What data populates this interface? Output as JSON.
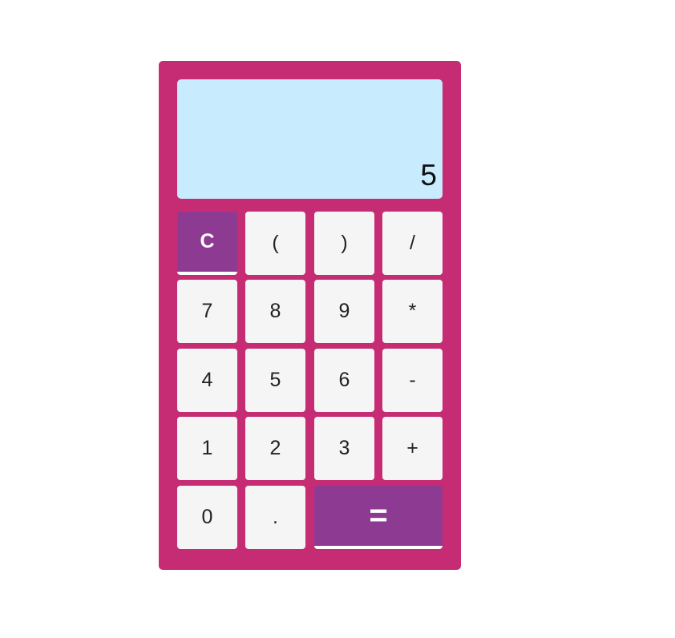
{
  "display": {
    "value": "5"
  },
  "keys": {
    "clear": "C",
    "open_paren": "(",
    "close_paren": ")",
    "divide": "/",
    "seven": "7",
    "eight": "8",
    "nine": "9",
    "multiply": "*",
    "four": "4",
    "five": "5",
    "six": "6",
    "subtract": "-",
    "one": "1",
    "two": "2",
    "three": "3",
    "add": "+",
    "zero": "0",
    "decimal": ".",
    "equals": "="
  },
  "colors": {
    "body": "#c62c73",
    "display": "#c8ecfe",
    "key": "#f5f5f5",
    "accent_key": "#8d3a93"
  }
}
